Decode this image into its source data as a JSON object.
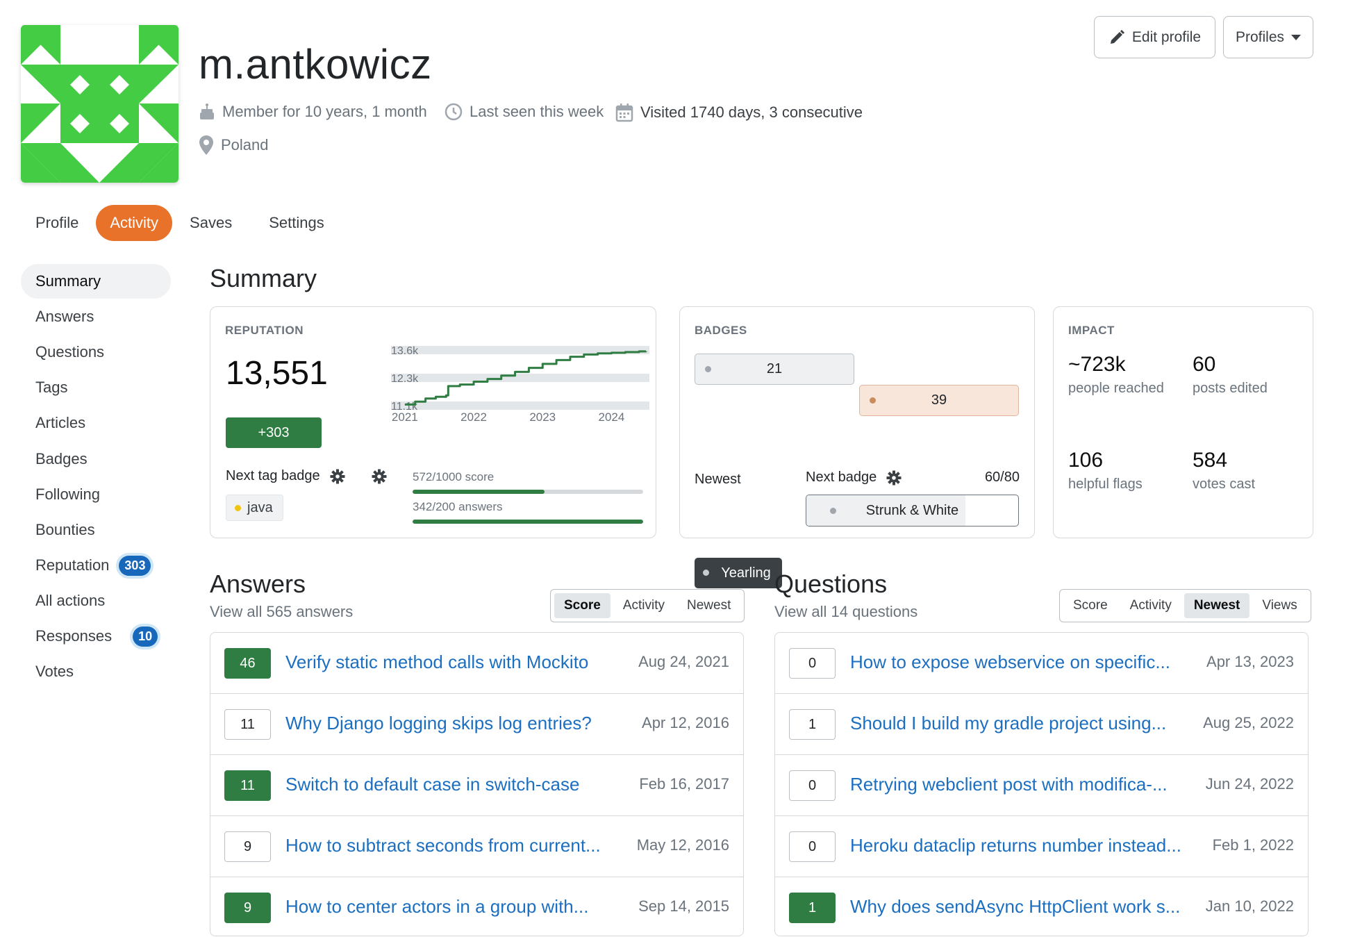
{
  "profile": {
    "username": "m.antkowicz",
    "member_for": "Member for 10 years, 1 month",
    "last_seen": "Last seen this week",
    "visited": "Visited 1740 days, 3 consecutive",
    "location": "Poland"
  },
  "header_buttons": {
    "edit_profile": "Edit profile",
    "profiles": "Profiles"
  },
  "tabs": [
    {
      "label": "Profile",
      "active": false
    },
    {
      "label": "Activity",
      "active": true
    },
    {
      "label": "Saves",
      "active": false
    },
    {
      "label": "Settings",
      "active": false
    }
  ],
  "sidebar": {
    "items": [
      {
        "label": "Summary",
        "active": true
      },
      {
        "label": "Answers"
      },
      {
        "label": "Questions"
      },
      {
        "label": "Tags"
      },
      {
        "label": "Articles"
      },
      {
        "label": "Badges"
      },
      {
        "label": "Following"
      },
      {
        "label": "Bounties"
      },
      {
        "label": "Reputation",
        "badge": "303"
      },
      {
        "label": "All actions"
      },
      {
        "label": "Responses",
        "badge": "10"
      },
      {
        "label": "Votes"
      }
    ]
  },
  "summary": {
    "title": "Summary",
    "reputation": {
      "label": "REPUTATION",
      "value": "13,551",
      "change": "+303",
      "next_tag_badge_label": "Next tag badge",
      "tag": "java",
      "progress": [
        {
          "text": "572/1000 score",
          "fraction": 0.572
        },
        {
          "text": "342/200 answers",
          "fraction": 1.0
        }
      ]
    },
    "badges": {
      "label": "BADGES",
      "silver_count": "21",
      "bronze_count": "39",
      "newest_label": "Newest",
      "newest_badge": "Yearling",
      "next_badge_label": "Next badge",
      "next_badge_progress": "60/80",
      "next_badge_fraction": 0.75,
      "next_badge_name": "Strunk & White"
    },
    "impact": {
      "label": "IMPACT",
      "stats": [
        {
          "value": "~723k",
          "label": "people reached"
        },
        {
          "value": "60",
          "label": "posts edited"
        },
        {
          "value": "106",
          "label": "helpful flags"
        },
        {
          "value": "584",
          "label": "votes cast"
        }
      ]
    }
  },
  "chart_data": {
    "type": "line",
    "title": "",
    "xlabel": "",
    "ylabel": "",
    "x_ticks": [
      "2021",
      "2022",
      "2023",
      "2024"
    ],
    "y_ticks": [
      "11.1k",
      "12.3k",
      "13.6k"
    ],
    "xlim": [
      2020.8,
      2024.55
    ],
    "ylim": [
      11100,
      13600
    ],
    "grid": true,
    "series": [
      {
        "x": [
          2021.0,
          2021.15,
          2021.3,
          2021.45,
          2021.6,
          2021.63,
          2021.8,
          2022.0,
          2022.2,
          2022.4,
          2022.6,
          2022.8,
          2023.0,
          2023.2,
          2023.4,
          2023.6,
          2023.8,
          2024.0,
          2024.2,
          2024.4,
          2024.5
        ],
        "y": [
          11150,
          11280,
          11420,
          11500,
          11560,
          11980,
          12050,
          12180,
          12300,
          12450,
          12620,
          12800,
          12980,
          13150,
          13300,
          13400,
          13450,
          13480,
          13510,
          13540,
          13551
        ]
      }
    ]
  },
  "answers": {
    "title": "Answers",
    "subtitle": "View all 565 answers",
    "sort_options": [
      "Score",
      "Activity",
      "Newest"
    ],
    "sort_active": "Score",
    "items": [
      {
        "score": "46",
        "accepted": true,
        "title": "Verify static method calls with Mockito",
        "date": "Aug 24, 2021"
      },
      {
        "score": "11",
        "accepted": false,
        "title": "Why Django logging skips log entries?",
        "date": "Apr 12, 2016"
      },
      {
        "score": "11",
        "accepted": true,
        "title": "Switch to default case in switch-case",
        "date": "Feb 16, 2017"
      },
      {
        "score": "9",
        "accepted": false,
        "title": "How to subtract seconds from current...",
        "date": "May 12, 2016"
      },
      {
        "score": "9",
        "accepted": true,
        "title": "How to center actors in a group with...",
        "date": "Sep 14, 2015"
      }
    ]
  },
  "questions": {
    "title": "Questions",
    "subtitle": "View all 14 questions",
    "sort_options": [
      "Score",
      "Activity",
      "Newest",
      "Views"
    ],
    "sort_active": "Newest",
    "items": [
      {
        "score": "0",
        "accepted": false,
        "title": "How to expose webservice on specific...",
        "date": "Apr 13, 2023"
      },
      {
        "score": "1",
        "accepted": false,
        "title": "Should I build my gradle project using...",
        "date": "Aug 25, 2022"
      },
      {
        "score": "0",
        "accepted": false,
        "title": "Retrying webclient post with modifica-...",
        "date": "Jun 24, 2022"
      },
      {
        "score": "0",
        "accepted": false,
        "title": "Heroku dataclip returns number instead...",
        "date": "Feb 1, 2022"
      },
      {
        "score": "1",
        "accepted": true,
        "title": "Why does sendAsync HttpClient work s...",
        "date": "Jan 10, 2022"
      }
    ]
  },
  "colors": {
    "accent_tab": "#e8722a",
    "green": "#2f7d43",
    "link": "#1c6fc0",
    "avatar_green": "#44cc44"
  },
  "icons": [
    "pencil-icon",
    "caret-down-icon",
    "cake-icon",
    "clock-icon",
    "calendar-icon",
    "location-pin-icon",
    "gear-icon"
  ]
}
